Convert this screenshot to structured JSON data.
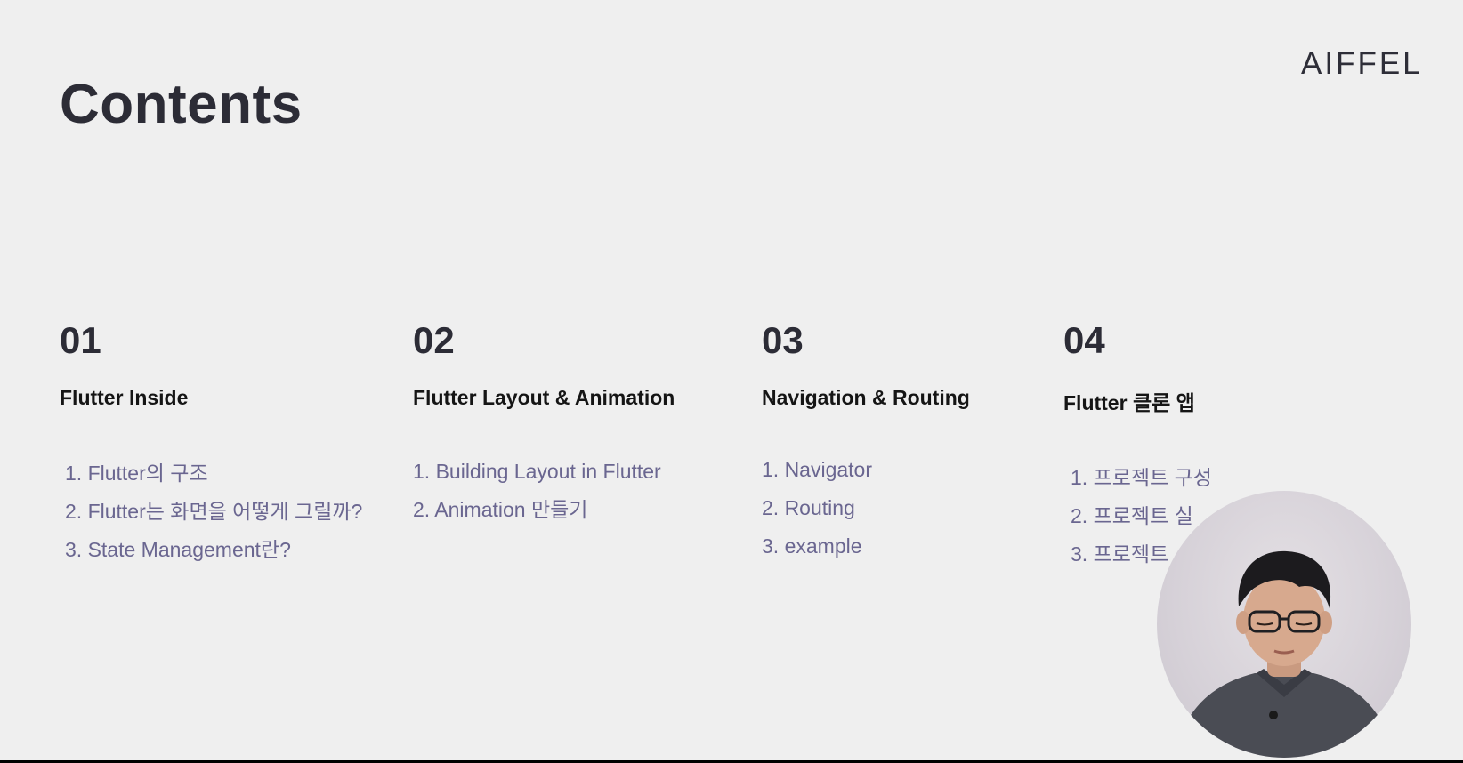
{
  "slide": {
    "title": "Contents",
    "logo": "AIFFEL"
  },
  "sections": [
    {
      "number": "01",
      "heading": "Flutter Inside",
      "items": [
        "1. Flutter의 구조",
        "2. Flutter는 화면을 어떻게 그릴까?",
        "3. State Management란?"
      ]
    },
    {
      "number": "02",
      "heading": "Flutter Layout & Animation",
      "items": [
        "1. Building Layout in Flutter",
        "2. Animation 만들기"
      ]
    },
    {
      "number": "03",
      "heading": "Navigation & Routing",
      "items": [
        "1. Navigator",
        "2. Routing",
        "3. example"
      ]
    },
    {
      "number": "04",
      "heading": "Flutter 클론 앱",
      "items": [
        "1. 프로젝트 구성",
        "2. 프로젝트 실",
        "3. 프로젝트"
      ]
    }
  ],
  "colors": {
    "background": "#efefef",
    "title": "#2c2c36",
    "heading": "#151515",
    "item": "#6a6690"
  }
}
